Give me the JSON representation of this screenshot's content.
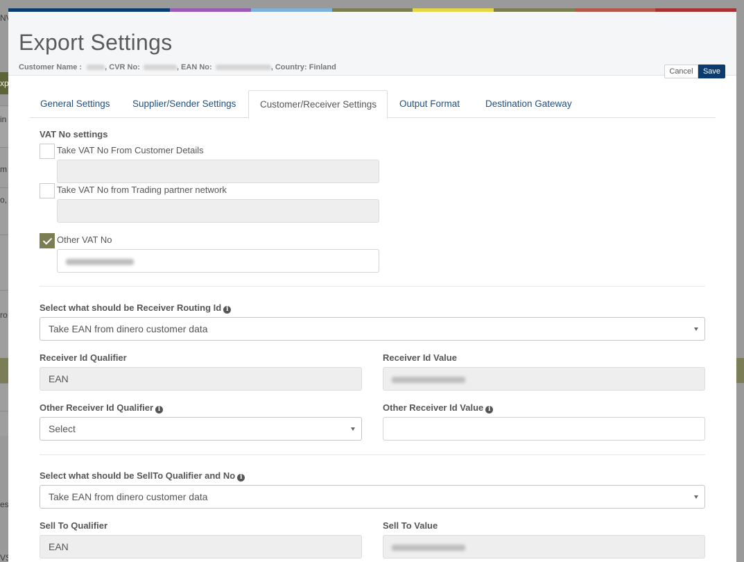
{
  "header": {
    "title": "Export Settings",
    "customer_name_label": "Customer Name :",
    "cvr_label": ", CVR No:",
    "ean_label": ", EAN No:",
    "country_label": ", Country: Finland",
    "cancel_label": "Cancel",
    "save_label": "Save"
  },
  "colors": {
    "bar": [
      "#0c3c6d",
      "#0c3c6d",
      "#9b59b6",
      "#7fb0d8",
      "#7b7d52",
      "#e6d544",
      "#7b7d52",
      "#b45a4a",
      "#a83232"
    ],
    "save_button": "#0c3c6d",
    "checkbox_checked": "#7b7d52"
  },
  "tabs": [
    {
      "label": "General Settings"
    },
    {
      "label": "Supplier/Sender Settings"
    },
    {
      "label": "Customer/Receiver Settings"
    },
    {
      "label": "Output Format"
    },
    {
      "label": "Destination Gateway"
    }
  ],
  "vat": {
    "section_label": "VAT No settings",
    "opt1_label": "Take VAT No From Customer Details",
    "opt1_checked": false,
    "opt2_label": "Take VAT No from Trading partner network",
    "opt2_checked": false,
    "opt3_label": "Other VAT No",
    "opt3_checked": true
  },
  "routing": {
    "label": "Select what should be Receiver Routing Id",
    "selected": "Take EAN from dinero customer data"
  },
  "receiver": {
    "qualifier_label": "Receiver Id Qualifier",
    "qualifier_value": "EAN",
    "value_label": "Receiver Id Value",
    "other_qualifier_label": "Other Receiver Id Qualifier",
    "other_qualifier_selected": "Select",
    "other_value_label": "Other Receiver Id Value"
  },
  "sellto": {
    "label": "Select what should be SellTo Qualifier and No",
    "selected": "Take EAN from dinero customer data",
    "qualifier_label": "Sell To Qualifier",
    "qualifier_value": "EAN",
    "value_label": "Sell To Value"
  },
  "background": {
    "fragments": [
      "NV",
      "xpo",
      "in",
      "m",
      "o,",
      "ro",
      "es",
      "VS"
    ]
  }
}
